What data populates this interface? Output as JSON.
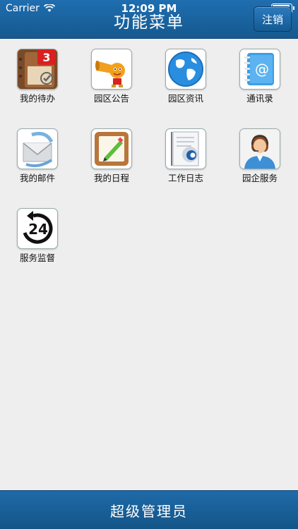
{
  "status": {
    "carrier": "Carrier",
    "time": "12:09 PM"
  },
  "header": {
    "title": "功能菜单",
    "logout_label": "注销"
  },
  "menu": [
    {
      "label": "我的待办",
      "icon": "todo-planner-icon",
      "badge": "3"
    },
    {
      "label": "园区公告",
      "icon": "announcement-horn-icon"
    },
    {
      "label": "园区资讯",
      "icon": "globe-icon"
    },
    {
      "label": "通讯录",
      "icon": "address-book-icon"
    },
    {
      "label": "我的邮件",
      "icon": "mail-envelope-icon"
    },
    {
      "label": "我的日程",
      "icon": "schedule-notepad-icon"
    },
    {
      "label": "工作日志",
      "icon": "work-log-document-icon"
    },
    {
      "label": "园企服务",
      "icon": "customer-service-agent-icon"
    },
    {
      "label": "服务监督",
      "icon": "24-hour-service-icon"
    }
  ],
  "footer": {
    "role": "超级管理员"
  },
  "colors": {
    "bar": "#1a64a0",
    "background": "#eeeeee",
    "badge": "#d8201f"
  }
}
